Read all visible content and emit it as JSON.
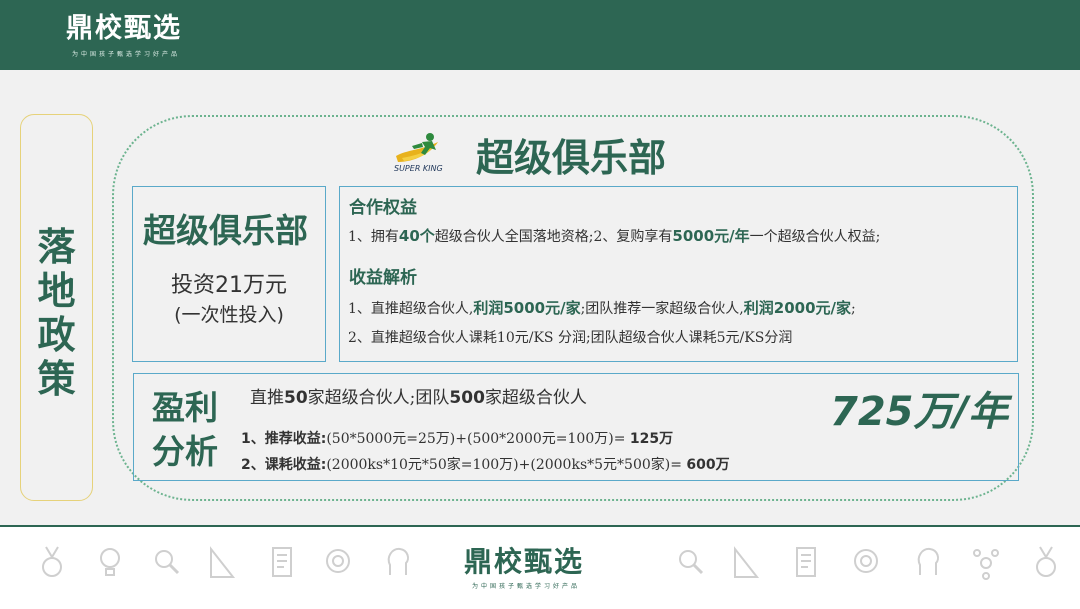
{
  "header": {
    "logo_text": "鼎校甄选",
    "logo_sub": "为中国孩子甄选学习好产品"
  },
  "side": {
    "label": "落地政策"
  },
  "club": {
    "title": "超级俱乐部",
    "brand": "SUPER KING"
  },
  "invest": {
    "title": "超级俱乐部",
    "amount": "投资21万元",
    "note": "(一次性投入)"
  },
  "rights": {
    "label": "合作权益",
    "line1_a": "1、拥有",
    "line1_b": "40个",
    "line1_c": "超级合伙人全国落地资格;2、复购享有",
    "line1_d": "5000元/年",
    "line1_e": "一个超级合伙人权益;"
  },
  "income": {
    "label": "收益解析",
    "line1_a": "1、直推超级合伙人,",
    "line1_b": "利润5000元/家",
    "line1_c": ";团队推荐一家超级合伙人,",
    "line1_d": "利润2000元/家",
    "line1_e": ";",
    "line2": "2、直推超级合伙人课耗10元/KS 分润;团队超级合伙人课耗5元/KS分润"
  },
  "profit": {
    "title_1": "盈利",
    "title_2": "分析",
    "line1_a": "直推",
    "line1_b": "50",
    "line1_c": "家超级合伙人;团队",
    "line1_d": "500",
    "line1_e": "家超级合伙人",
    "row1_label": "1、推荐收益:",
    "row1_formula": "(50*5000元=25万)+(500*2000元=100万)= ",
    "row1_result": "125万",
    "row2_label": "2、课耗收益:",
    "row2_formula": "(2000ks*10元*50家=100万)+(2000ks*5元*500家)= ",
    "row2_result": "600万",
    "big": "725万/年"
  },
  "footer": {
    "logo_text": "鼎校甄选",
    "logo_sub": "为中国孩子甄选学习好产品",
    "icons": [
      "medal-icon",
      "lightbulb-icon",
      "magnifier-icon",
      "ruler-icon",
      "document-icon",
      "globe-search-icon",
      "head-idea-icon",
      "magnifier-icon",
      "ruler-icon",
      "document-icon",
      "globe-search-icon",
      "head-idea-icon",
      "network-icon",
      "medal-icon"
    ]
  },
  "colors": {
    "primary": "#2d6653",
    "accent_border": "#5aa9c9",
    "side_border": "#e6d27a",
    "dotted": "#6cb38f",
    "background": "#f1f1f1"
  }
}
